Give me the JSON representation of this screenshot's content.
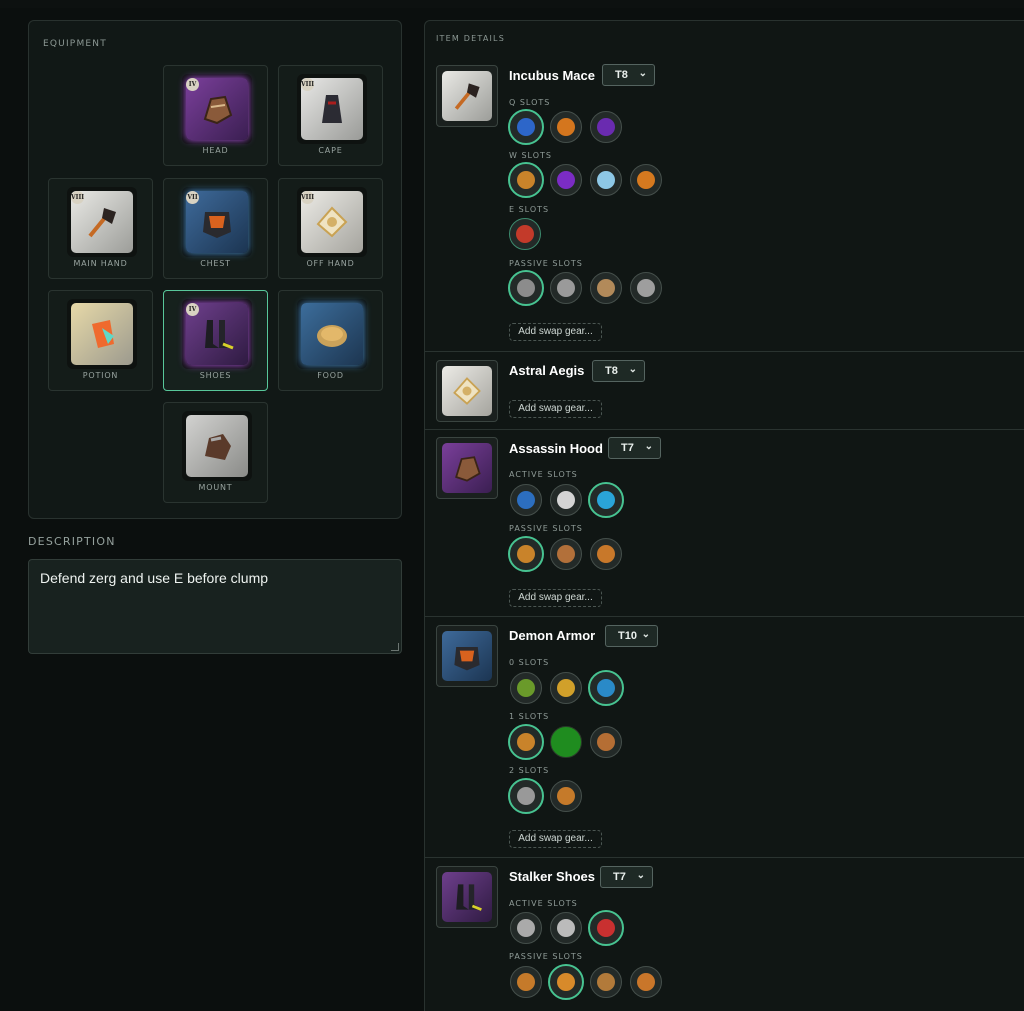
{
  "equipment": {
    "title": "EQUIPMENT",
    "slots": {
      "head": {
        "label": "HEAD",
        "tier": "IV"
      },
      "cape": {
        "label": "CAPE",
        "tier": "VIII"
      },
      "main_hand": {
        "label": "MAIN HAND",
        "tier": "VIII"
      },
      "chest": {
        "label": "CHEST",
        "tier": "VII"
      },
      "off_hand": {
        "label": "OFF HAND",
        "tier": "VIII"
      },
      "potion": {
        "label": "POTION"
      },
      "shoes": {
        "label": "SHOES",
        "tier": "IV"
      },
      "food": {
        "label": "FOOD"
      },
      "mount": {
        "label": "MOUNT"
      }
    }
  },
  "description": {
    "title": "DESCRIPTION",
    "text": "Defend zerg and use E before clump"
  },
  "item_details": {
    "title": "ITEM DETAILS",
    "swap_label": "Add swap gear...",
    "items": [
      {
        "name": "Incubus Mace",
        "tier": "T8",
        "groups": [
          {
            "label": "Q SLOTS"
          },
          {
            "label": "W SLOTS"
          },
          {
            "label": "E SLOTS"
          },
          {
            "label": "PASSIVE SLOTS"
          }
        ]
      },
      {
        "name": "Astral Aegis",
        "tier": "T8",
        "groups": []
      },
      {
        "name": "Assassin Hood",
        "tier": "T7",
        "groups": [
          {
            "label": "ACTIVE SLOTS"
          },
          {
            "label": "PASSIVE SLOTS"
          }
        ]
      },
      {
        "name": "Demon Armor",
        "tier": "T10",
        "groups": [
          {
            "label": "0 SLOTS"
          },
          {
            "label": "1 SLOTS"
          },
          {
            "label": "2 SLOTS"
          }
        ]
      },
      {
        "name": "Stalker Shoes",
        "tier": "T7",
        "groups": [
          {
            "label": "ACTIVE SLOTS"
          },
          {
            "label": "PASSIVE SLOTS"
          }
        ]
      }
    ]
  },
  "colors": {
    "accent": "#47c391",
    "panel_bg": "#111816",
    "selected_green": "#1f8c1f"
  }
}
